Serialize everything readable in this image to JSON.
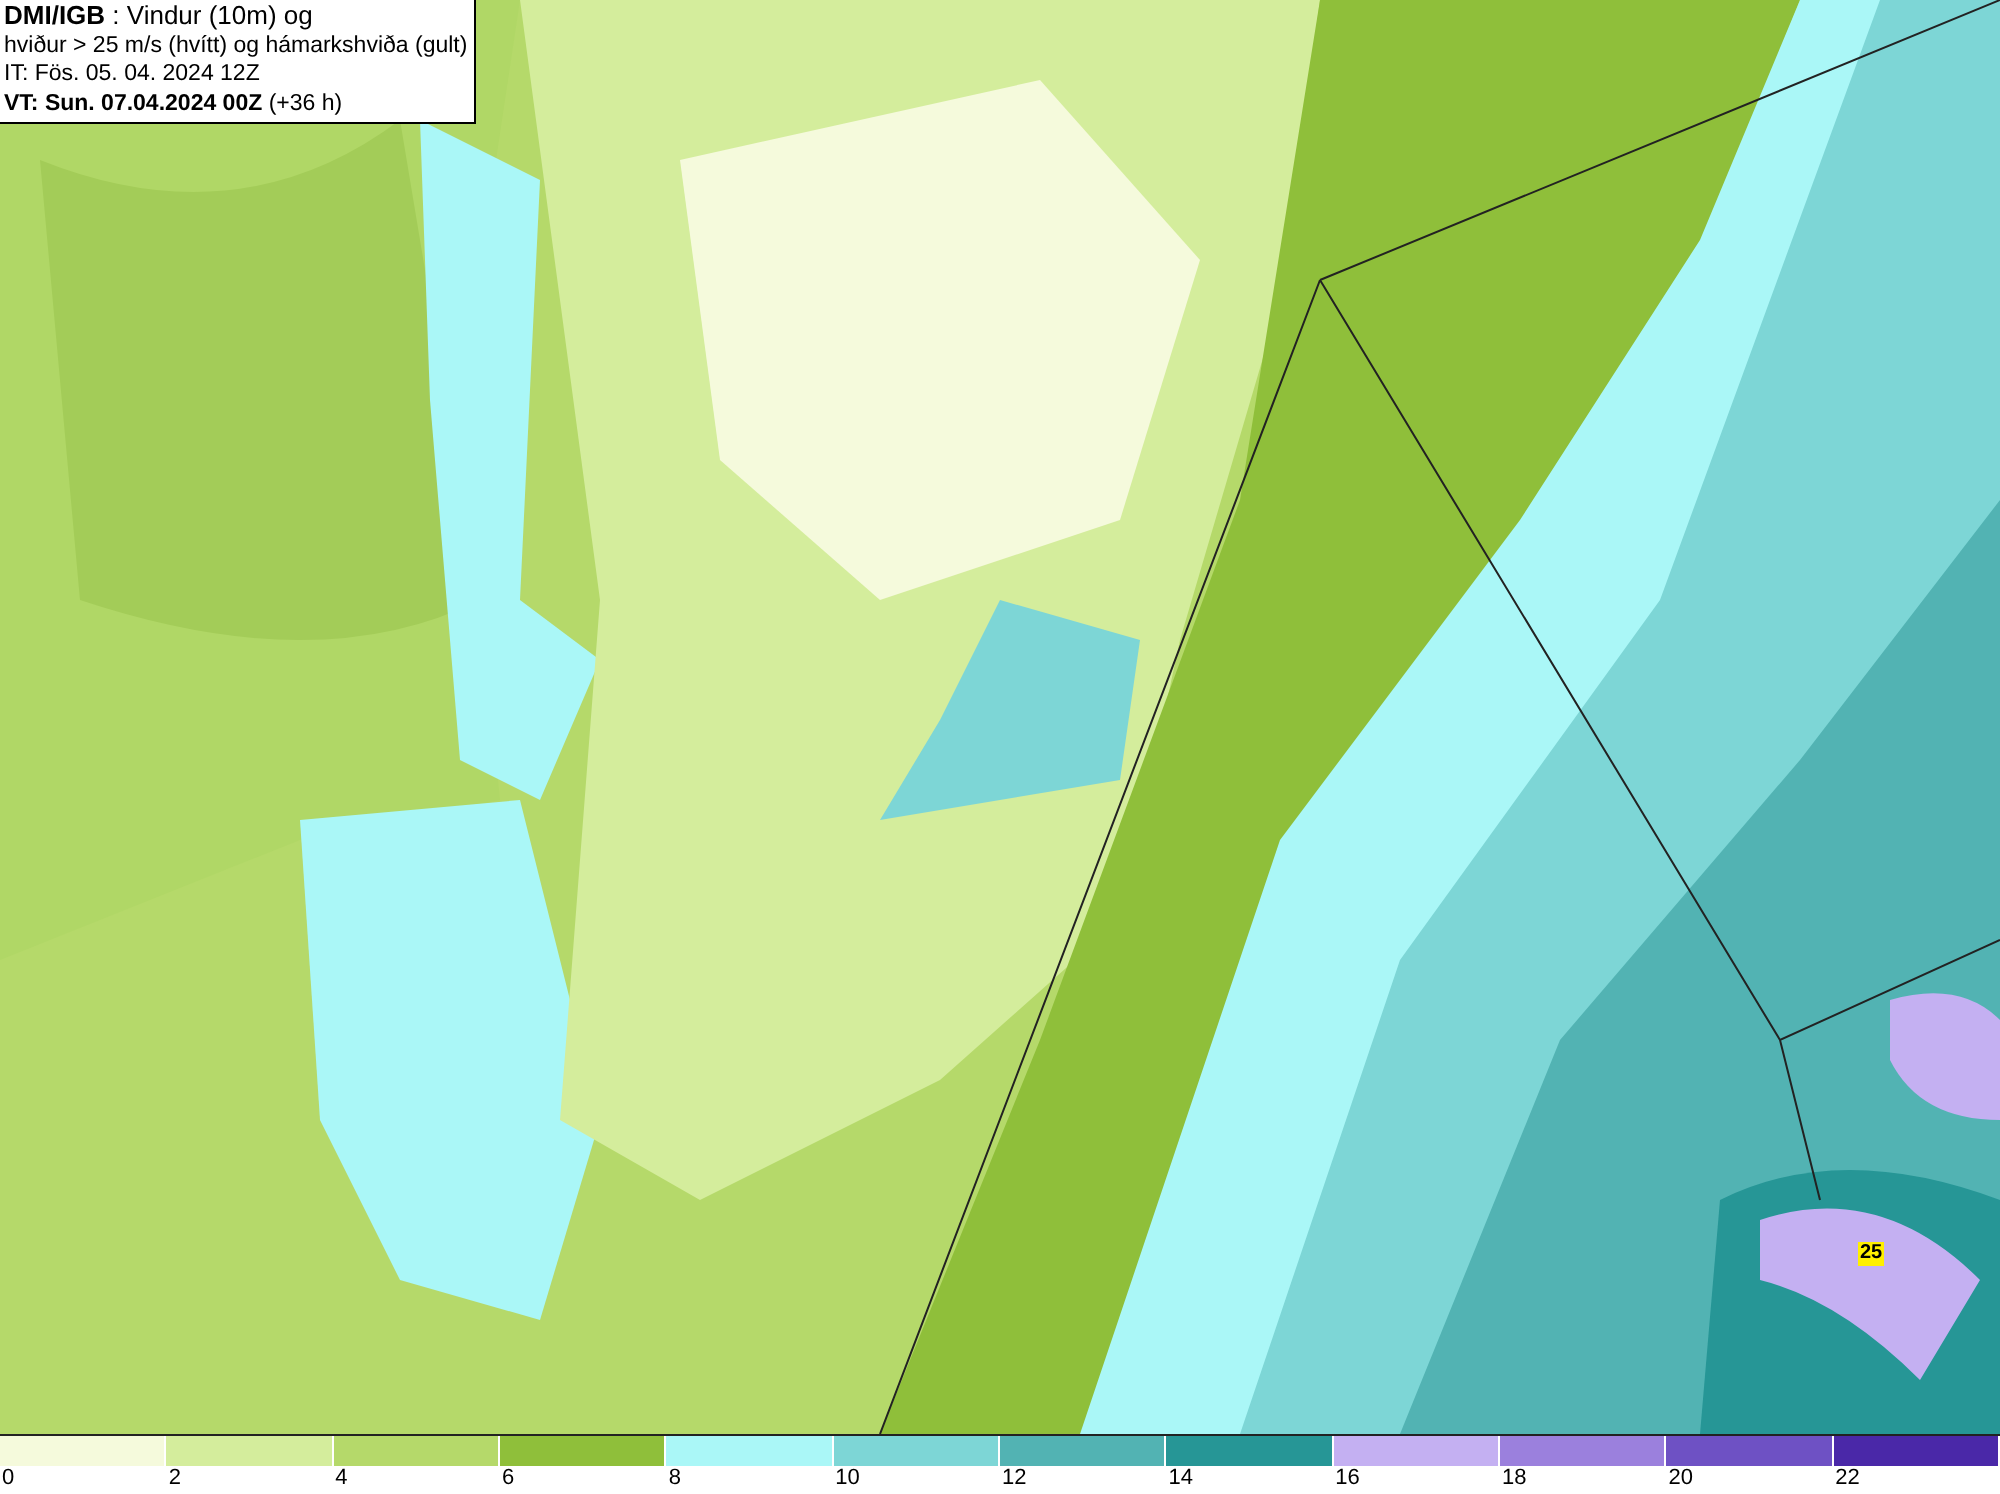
{
  "header": {
    "lines": [
      "**DMI/IGB** : Vindur (10m) og",
      "hviður > 25 m/s (hvítt) og hámarkshviða (gult)",
      "IT: Fös. 05. 04. 2024 12Z",
      "**VT: Sun. 07.04.2024 00Z** (+36 h)"
    ]
  },
  "gust_marker": {
    "label": "25"
  },
  "legend": [
    {
      "label": "0",
      "color": "#f5fadc"
    },
    {
      "label": "2",
      "color": "#d4ed9c"
    },
    {
      "label": "4",
      "color": "#b5d96a"
    },
    {
      "label": "6",
      "color": "#8fbf3a"
    },
    {
      "label": "8",
      "color": "#aaf7f7"
    },
    {
      "label": "10",
      "color": "#7dd6d6"
    },
    {
      "label": "12",
      "color": "#52b3b3"
    },
    {
      "label": "14",
      "color": "#269696"
    },
    {
      "label": "16",
      "color": "#c4b0f2"
    },
    {
      "label": "18",
      "color": "#9b80dd"
    },
    {
      "label": "20",
      "color": "#6e51c4"
    },
    {
      "label": "22",
      "color": "#4a28a8"
    }
  ]
}
